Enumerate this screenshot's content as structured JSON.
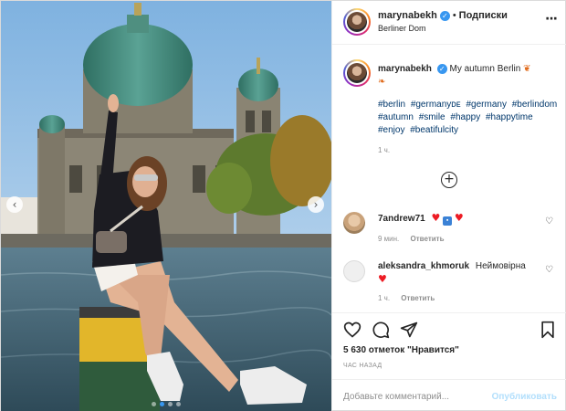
{
  "header": {
    "username": "marynabekh",
    "separator": "•",
    "follow_label": "Подписки",
    "location": "Berliner Dom",
    "more_icon": "more-horizontal-icon"
  },
  "caption": {
    "username": "marynabekh",
    "text": "My autumn Berlin",
    "hashtags": [
      "#berlin",
      "#germanyᴅᴇ",
      "#germany",
      "#berlindom",
      "#autumn",
      "#smile",
      "#happy",
      "#happytime",
      "#enjoy",
      "#beatifulcity"
    ],
    "time": "1 ч."
  },
  "comments": [
    {
      "username": "7andrew71",
      "time": "9 мин.",
      "reply_label": "Ответить"
    },
    {
      "username": "aleksandra_khmoruk",
      "text": "Неймовірна",
      "time": "1 ч.",
      "reply_label": "Ответить"
    }
  ],
  "actions": {
    "icons": [
      "heart-icon",
      "comment-icon",
      "share-icon",
      "bookmark-icon"
    ]
  },
  "likes_text": "5 630 отметок \"Нравится\"",
  "post_date": "ЧАС НАЗАД",
  "add_comment": {
    "placeholder": "Добавьте комментарий...",
    "publish_label": "Опубликовать"
  },
  "carousel": {
    "slide_count": 4,
    "active_index": 1
  },
  "colors": {
    "link": "#00376b",
    "accent": "#3897f0",
    "publish_disabled": "#b2dffc",
    "muted": "#8e8e8e"
  }
}
